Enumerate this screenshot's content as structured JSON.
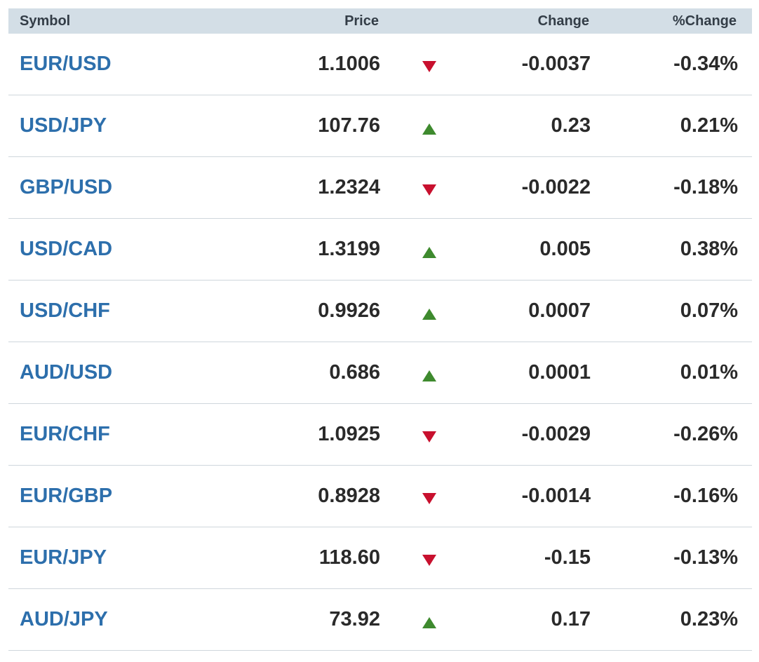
{
  "header": {
    "symbol": "Symbol",
    "price": "Price",
    "change": "Change",
    "pct_change": "%Change"
  },
  "colors": {
    "symbol_link": "#2d6fac",
    "up_arrow": "#3e8a2e",
    "down_arrow": "#c8102e",
    "header_bg": "#d3dee6"
  },
  "rows": [
    {
      "symbol": "EUR/USD",
      "price": "1.1006",
      "direction": "down",
      "arrow_icon": "down-triangle-icon",
      "change": "-0.0037",
      "pct_change": "-0.34%"
    },
    {
      "symbol": "USD/JPY",
      "price": "107.76",
      "direction": "up",
      "arrow_icon": "up-triangle-icon",
      "change": "0.23",
      "pct_change": "0.21%"
    },
    {
      "symbol": "GBP/USD",
      "price": "1.2324",
      "direction": "down",
      "arrow_icon": "down-triangle-icon",
      "change": "-0.0022",
      "pct_change": "-0.18%"
    },
    {
      "symbol": "USD/CAD",
      "price": "1.3199",
      "direction": "up",
      "arrow_icon": "up-triangle-icon",
      "change": "0.005",
      "pct_change": "0.38%"
    },
    {
      "symbol": "USD/CHF",
      "price": "0.9926",
      "direction": "up",
      "arrow_icon": "up-triangle-icon",
      "change": "0.0007",
      "pct_change": "0.07%"
    },
    {
      "symbol": "AUD/USD",
      "price": "0.686",
      "direction": "up",
      "arrow_icon": "up-triangle-icon",
      "change": "0.0001",
      "pct_change": "0.01%"
    },
    {
      "symbol": "EUR/CHF",
      "price": "1.0925",
      "direction": "down",
      "arrow_icon": "down-triangle-icon",
      "change": "-0.0029",
      "pct_change": "-0.26%"
    },
    {
      "symbol": "EUR/GBP",
      "price": "0.8928",
      "direction": "down",
      "arrow_icon": "down-triangle-icon",
      "change": "-0.0014",
      "pct_change": "-0.16%"
    },
    {
      "symbol": "EUR/JPY",
      "price": "118.60",
      "direction": "down",
      "arrow_icon": "down-triangle-icon",
      "change": "-0.15",
      "pct_change": "-0.13%"
    },
    {
      "symbol": "AUD/JPY",
      "price": "73.92",
      "direction": "up",
      "arrow_icon": "up-triangle-icon",
      "change": "0.17",
      "pct_change": "0.23%"
    }
  ]
}
